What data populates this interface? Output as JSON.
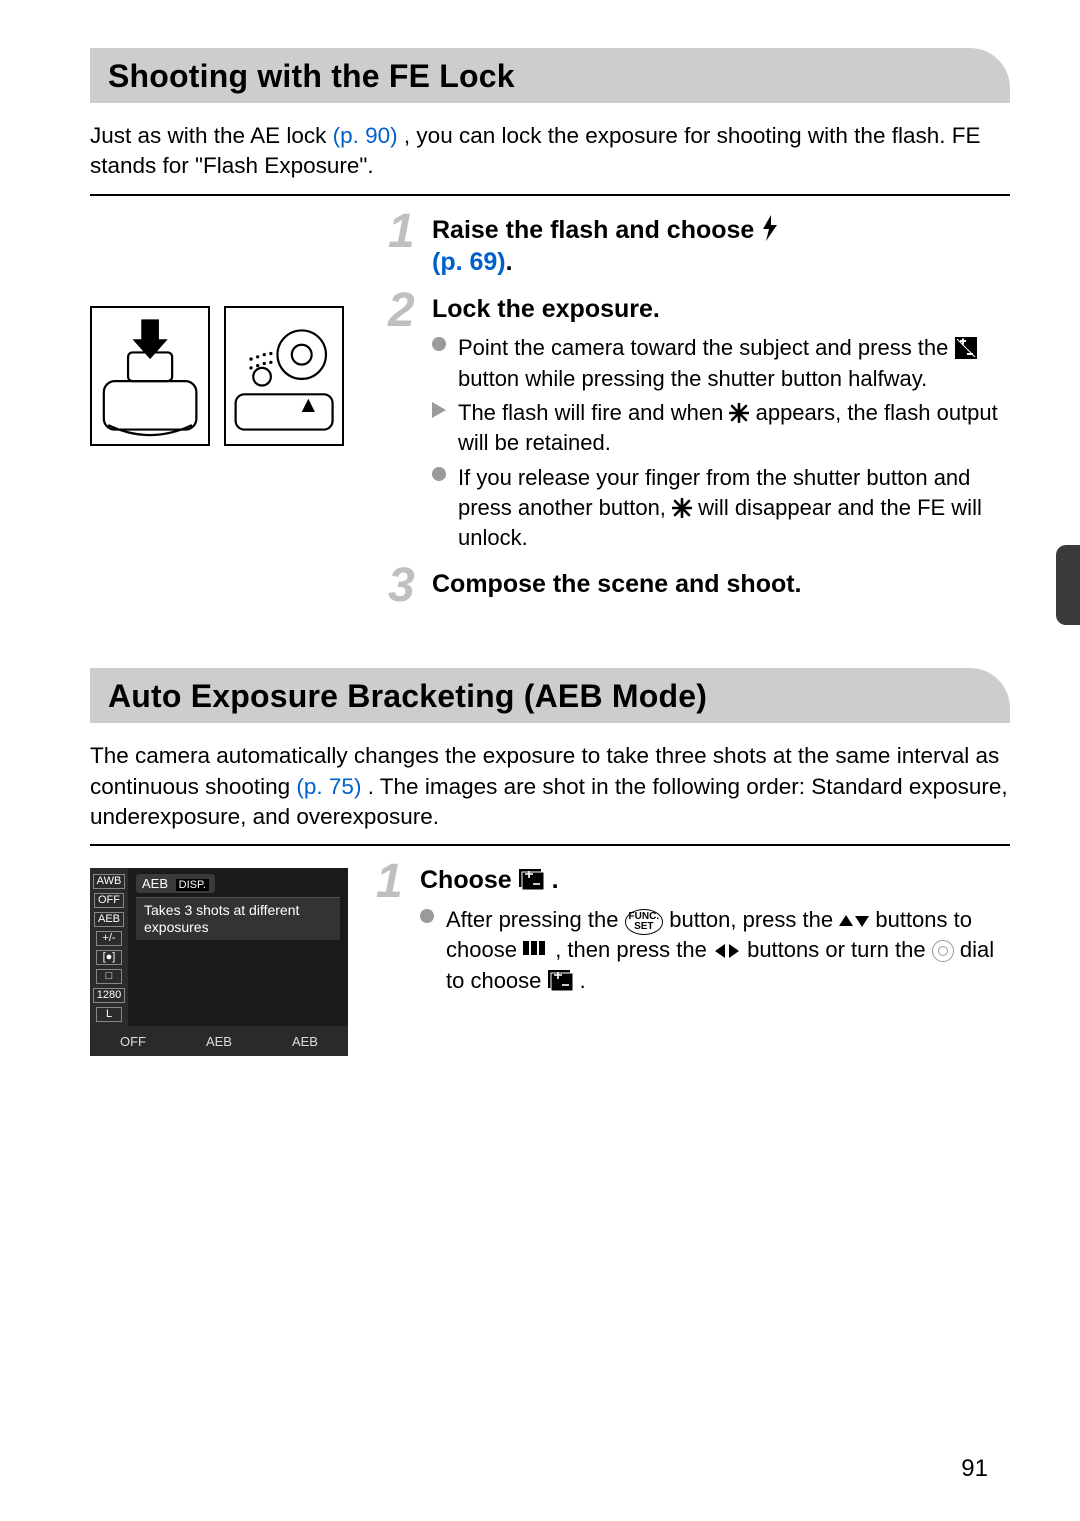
{
  "page_number": "91",
  "section_a": {
    "title": "Shooting with the FE Lock",
    "intro_before_ref": "Just as with the AE lock ",
    "intro_ref": "(p. 90)",
    "intro_after_ref": ", you can lock the exposure for shooting with the flash. FE stands for \"Flash Exposure\".",
    "steps": {
      "s1": {
        "num": "1",
        "heading_before_icon": "Raise the flash and choose ",
        "heading_link": "(p. 69)",
        "heading_suffix": "."
      },
      "s2": {
        "num": "2",
        "heading": "Lock the exposure.",
        "b1_before": "Point the camera toward the subject and press the ",
        "b1_after": " button while pressing the shutter button halfway.",
        "b2_before": "The flash will fire and when ",
        "b2_after": " appears, the flash output will be retained.",
        "b3_before": "If you release your finger from the shutter button and press another button, ",
        "b3_after": " will disappear and the FE will unlock."
      },
      "s3": {
        "num": "3",
        "heading": "Compose the scene and shoot."
      }
    }
  },
  "section_b": {
    "title": "Auto Exposure Bracketing (AEB Mode)",
    "intro_before_ref": "The camera automatically changes the exposure to take three shots at the same interval as continuous shooting ",
    "intro_ref": "(p. 75)",
    "intro_after_ref": ". The images are shot in the following order: Standard exposure, underexposure, and overexposure.",
    "screenshot": {
      "side_items": [
        "AWB",
        "OFF",
        "AEB",
        "+/-",
        "[●]",
        "□",
        "1280",
        "L"
      ],
      "banner_label": "AEB",
      "banner_key": "DISP.",
      "desc": "Takes 3 shots at different exposures",
      "bottom": [
        "OFF",
        "AEB",
        "AEB"
      ]
    },
    "steps": {
      "s1": {
        "num": "1",
        "heading_before_icon": "Choose ",
        "heading_suffix": ".",
        "b1_p1": "After pressing the ",
        "b1_p2": " button, press the ",
        "b1_p3": " buttons to choose ",
        "b1_p4": ", then press the ",
        "b1_p5": " buttons or turn the ",
        "b1_p6": " dial to choose ",
        "b1_p7": ".",
        "func_set_label": "FUNC.\nSET"
      }
    }
  }
}
